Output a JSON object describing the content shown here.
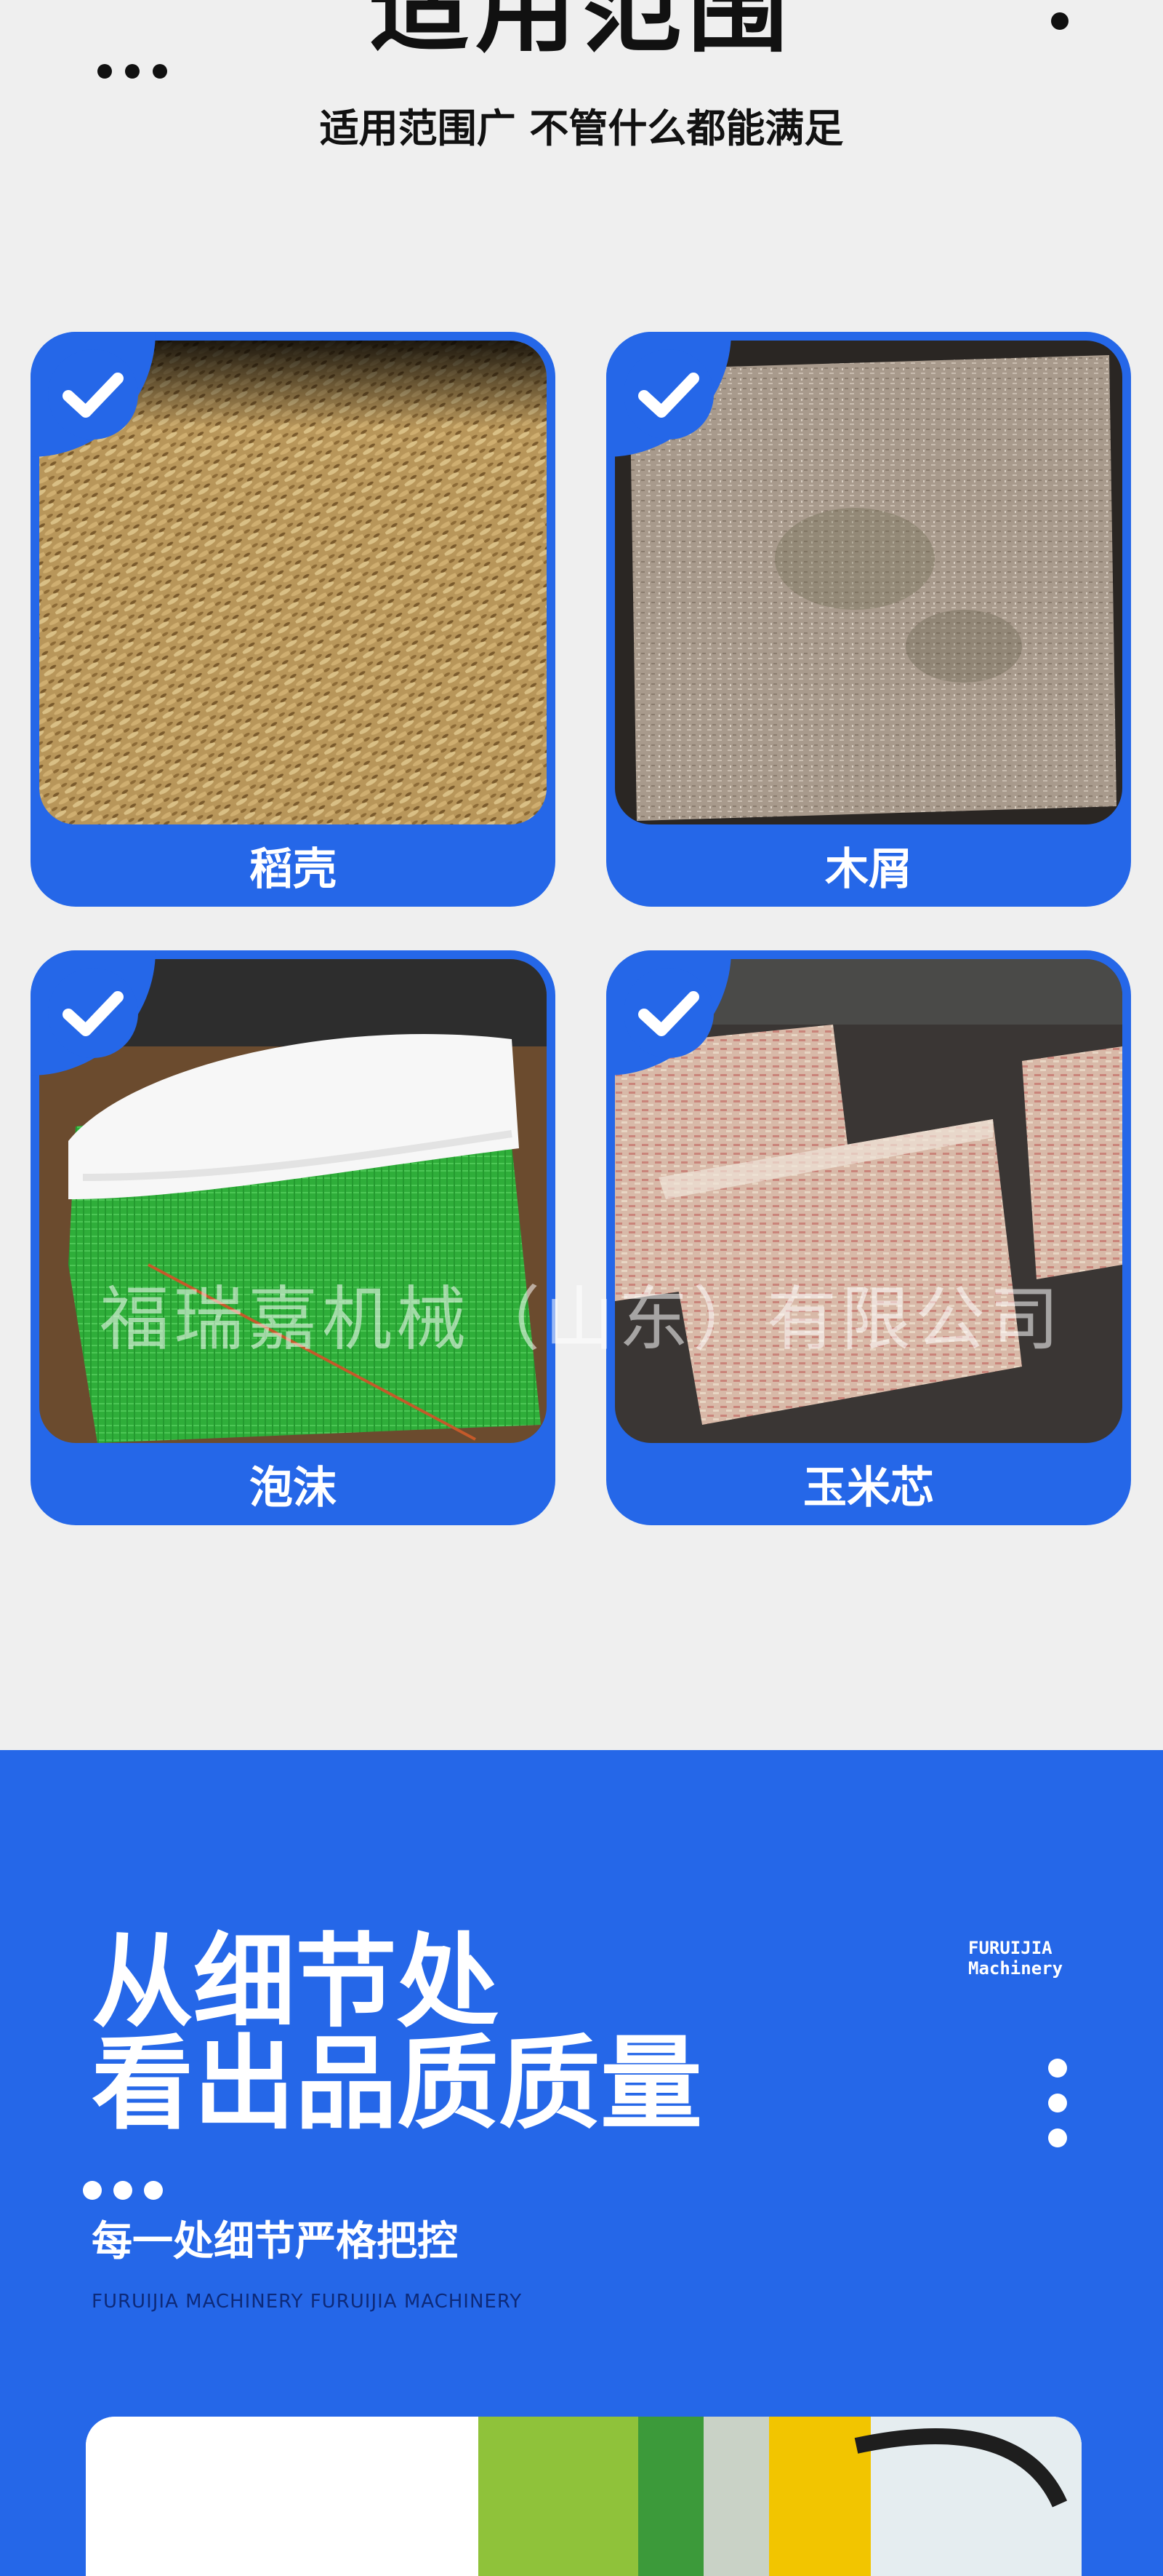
{
  "header": {
    "title": "适用范围",
    "subtitle": "适用范围广  不管什么都能满足"
  },
  "cards": [
    {
      "label": "稻壳",
      "photo": "rice-husk"
    },
    {
      "label": "木屑",
      "photo": "sawdust-block"
    },
    {
      "label": "泡沫",
      "photo": "foam-bag"
    },
    {
      "label": "玉米芯",
      "photo": "corn-cob-bale"
    }
  ],
  "watermark": "福瑞嘉机械（山东）有限公司",
  "detail_section": {
    "heading_line1": "从细节处",
    "heading_line2": "看出品质质量",
    "brand_line1": "FURUIJIA",
    "brand_line2": "Machinery",
    "tagline": "每一处细节严格把控",
    "english": "FURUIJIA  MACHINERY  FURUIJIA  MACHINERY"
  },
  "colors": {
    "accent": "#2567e8",
    "background": "#efefef",
    "text": "#111111"
  },
  "icons": [
    "check-icon"
  ]
}
